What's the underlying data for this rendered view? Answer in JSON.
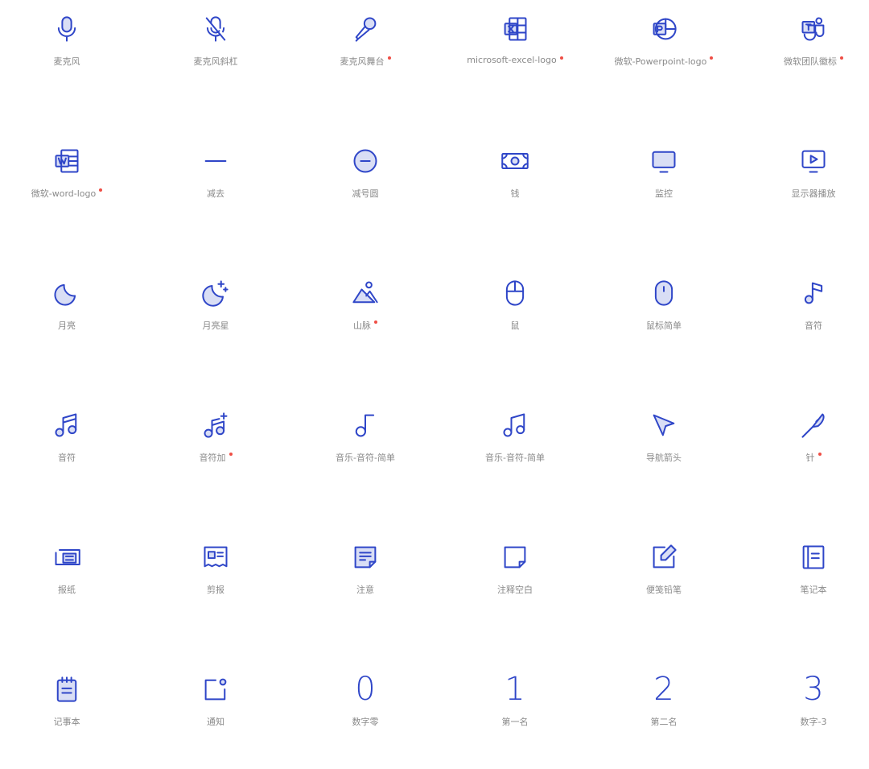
{
  "accent_color": "#2f46c8",
  "new_dot_color": "#ef4e45",
  "icons": [
    {
      "label": "麦克风",
      "icon": "microphone-icon",
      "is_new": false
    },
    {
      "label": "麦克风斜杠",
      "icon": "microphone-slash-icon",
      "is_new": false
    },
    {
      "label": "麦克风舞台",
      "icon": "stage-microphone-icon",
      "is_new": true
    },
    {
      "label": "microsoft-excel-logo",
      "icon": "excel-logo-icon",
      "is_new": true
    },
    {
      "label": "微软-Powerpoint-logo",
      "icon": "powerpoint-logo-icon",
      "is_new": true
    },
    {
      "label": "微软团队徽标",
      "icon": "teams-logo-icon",
      "is_new": true
    },
    {
      "label": "微软-word-logo",
      "icon": "word-logo-icon",
      "is_new": true
    },
    {
      "label": "减去",
      "icon": "minus-icon",
      "is_new": false
    },
    {
      "label": "减号圆",
      "icon": "minus-circle-icon",
      "is_new": false
    },
    {
      "label": "钱",
      "icon": "money-icon",
      "is_new": false
    },
    {
      "label": "监控",
      "icon": "monitor-icon",
      "is_new": false
    },
    {
      "label": "显示器播放",
      "icon": "monitor-play-icon",
      "is_new": false
    },
    {
      "label": "月亮",
      "icon": "moon-icon",
      "is_new": false
    },
    {
      "label": "月亮星",
      "icon": "moon-star-icon",
      "is_new": false
    },
    {
      "label": "山脉",
      "icon": "mountains-icon",
      "is_new": true
    },
    {
      "label": "鼠",
      "icon": "mouse-icon",
      "is_new": false
    },
    {
      "label": "鼠标简单",
      "icon": "mouse-simple-icon",
      "is_new": false
    },
    {
      "label": "音符",
      "icon": "music-note-icon",
      "is_new": false
    },
    {
      "label": "音符",
      "icon": "music-notes-icon",
      "is_new": false
    },
    {
      "label": "音符加",
      "icon": "music-notes-plus-icon",
      "is_new": true
    },
    {
      "label": "音乐-音符-简单",
      "icon": "music-note-simple-icon",
      "is_new": false
    },
    {
      "label": "音乐-音符-简单",
      "icon": "music-notes-simple-icon",
      "is_new": false
    },
    {
      "label": "导航箭头",
      "icon": "navigation-arrow-icon",
      "is_new": false
    },
    {
      "label": "针",
      "icon": "needle-icon",
      "is_new": true
    },
    {
      "label": "报纸",
      "icon": "newspaper-icon",
      "is_new": false
    },
    {
      "label": "剪报",
      "icon": "newspaper-clipping-icon",
      "is_new": false
    },
    {
      "label": "注意",
      "icon": "note-icon",
      "is_new": false
    },
    {
      "label": "注释空白",
      "icon": "note-blank-icon",
      "is_new": false
    },
    {
      "label": "便笺铅笔",
      "icon": "note-pencil-icon",
      "is_new": false
    },
    {
      "label": "笔记本",
      "icon": "notebook-icon",
      "is_new": false
    },
    {
      "label": "记事本",
      "icon": "notepad-icon",
      "is_new": false
    },
    {
      "label": "通知",
      "icon": "notification-icon",
      "is_new": false
    },
    {
      "label": "数字零",
      "icon": "number-zero-icon",
      "glyph": "0",
      "is_new": false
    },
    {
      "label": "第一名",
      "icon": "number-one-icon",
      "glyph": "1",
      "is_new": false
    },
    {
      "label": "第二名",
      "icon": "number-two-icon",
      "glyph": "2",
      "is_new": false
    },
    {
      "label": "数字-3",
      "icon": "number-three-icon",
      "glyph": "3",
      "is_new": false
    }
  ]
}
